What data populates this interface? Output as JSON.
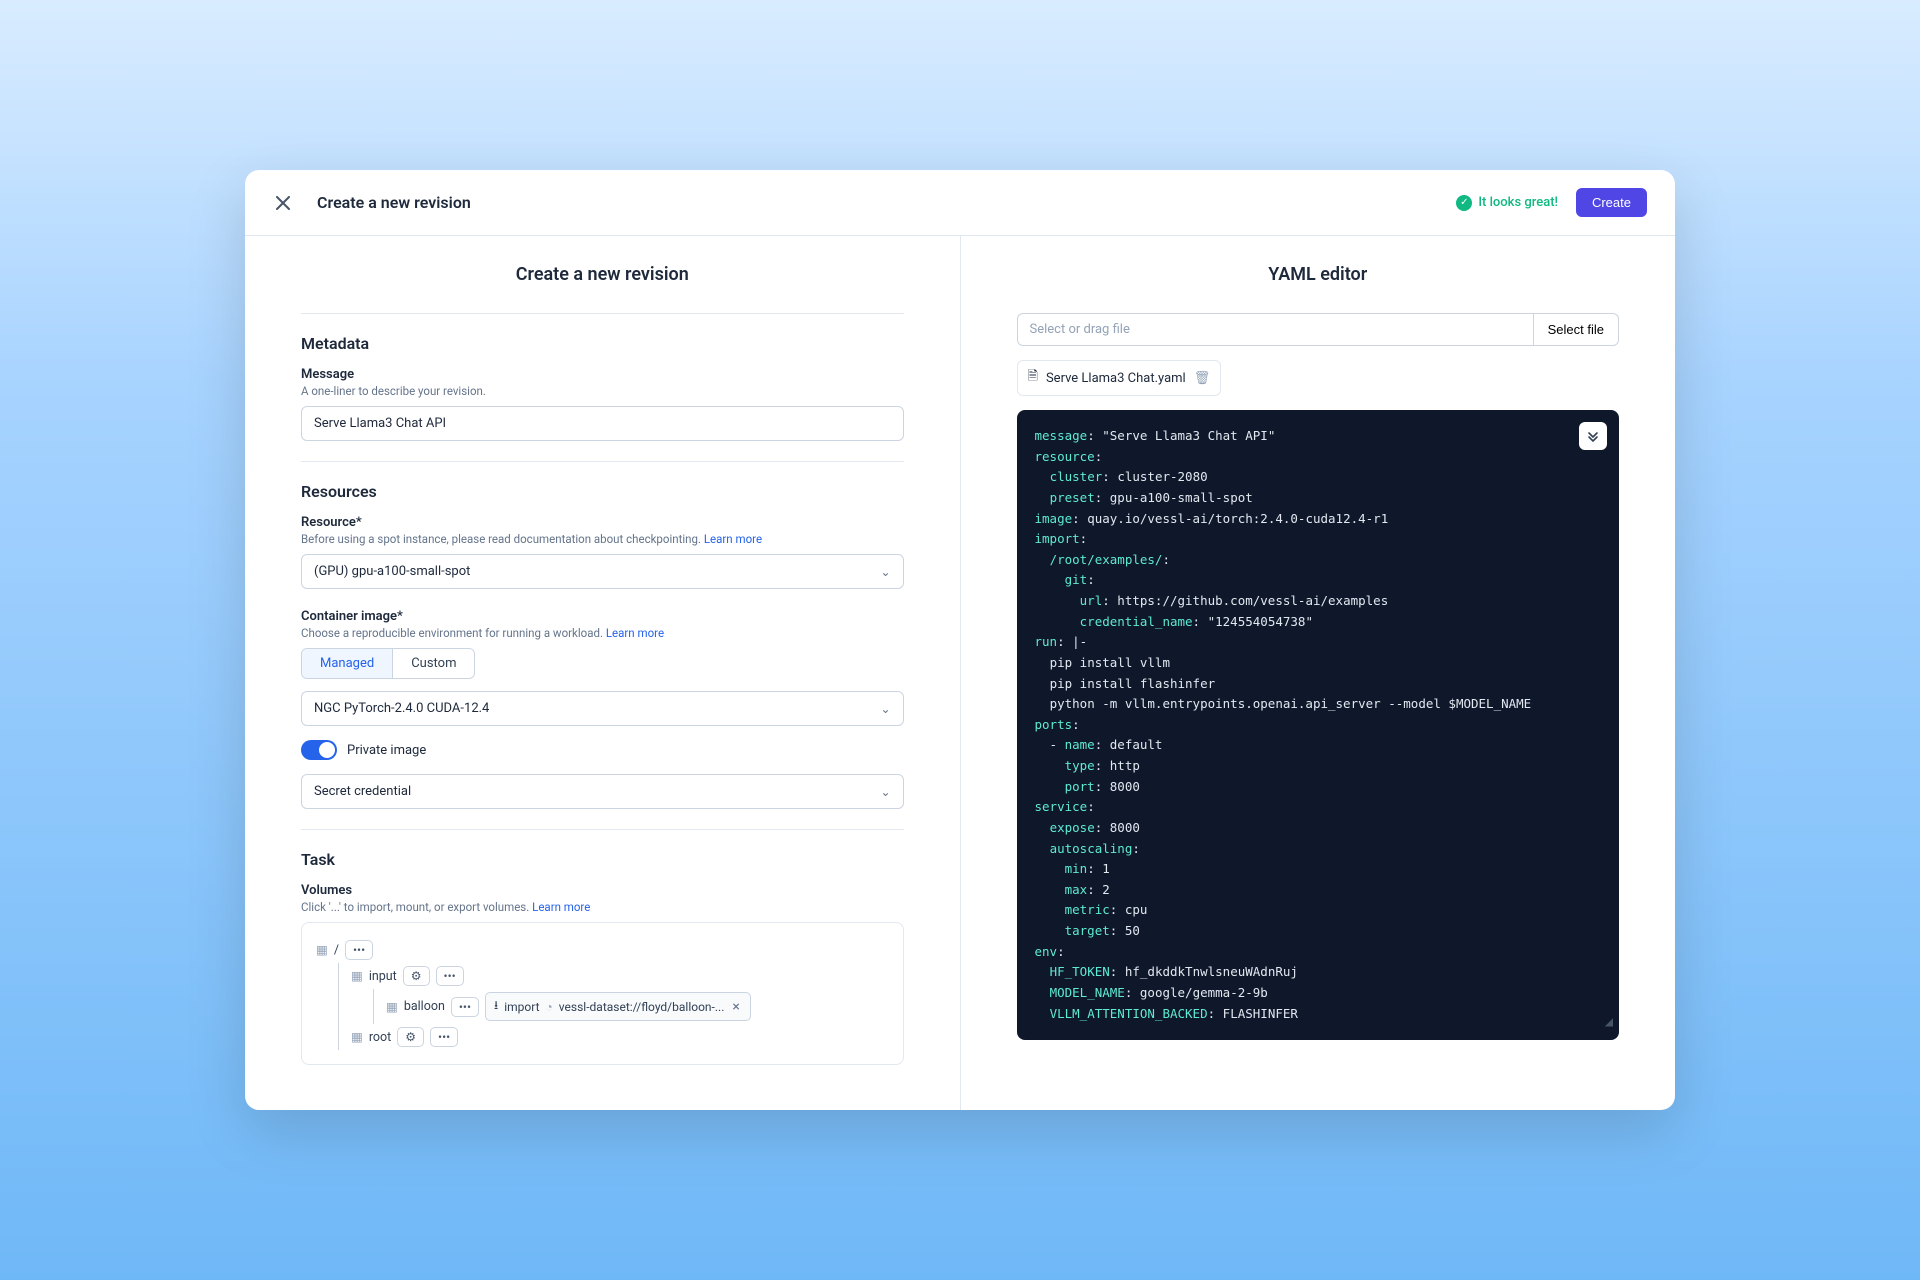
{
  "titlebar": {
    "title": "Create a new revision",
    "status_text": "It looks great!",
    "create_button": "Create"
  },
  "left_panel_title": "Create a new revision",
  "metadata": {
    "heading": "Metadata",
    "message_label": "Message",
    "message_note": "A one-liner to describe your revision.",
    "message_value": "Serve Llama3 Chat API"
  },
  "resources": {
    "heading": "Resources",
    "resource_label": "Resource*",
    "resource_note": "Before using a spot instance, please read documentation about checkpointing.",
    "resource_value": "(GPU) gpu-a100-small-spot",
    "image_label": "Container image*",
    "image_note": "Choose a reproducible environment for running a workload.",
    "tabs": {
      "managed": "Managed",
      "custom": "Custom"
    },
    "image_value": "NGC PyTorch-2.4.0 CUDA-12.4",
    "private_image_label": "Private image",
    "credential_value": "Secret credential",
    "learn_more": "Learn more"
  },
  "task": {
    "heading": "Task",
    "volumes_label": "Volumes",
    "volumes_note": "Click '...' to import, mount, or export volumes.",
    "root": "/",
    "folders": {
      "input": "input",
      "balloon": "balloon",
      "root": "root"
    },
    "import_label": "import",
    "import_path": "vessl-dataset://floyd/balloon-..."
  },
  "right_panel_title": "YAML editor",
  "file_picker": {
    "placeholder": "Select or drag file",
    "button": "Select file"
  },
  "file_pill": "Serve Llama3 Chat.yaml",
  "yaml": {
    "message": "\"Serve Llama3 Chat API\"",
    "resource": {
      "cluster": "cluster-2080",
      "preset": "gpu-a100-small-spot"
    },
    "image": "quay.io/vessl-ai/torch:2.4.0-cuda12.4-r1",
    "import_path": "/root/examples/",
    "git_url": "https://github.com/vessl-ai/examples",
    "git_credential": "\"124554054738\"",
    "run_lines": {
      "indicator": "|-",
      "l1": "pip install vllm",
      "l2": "pip install flashinfer",
      "l3": "python -m vllm.entrypoints.openai.api_server --model $MODEL_NAME"
    },
    "ports": {
      "name": "default",
      "type": "http",
      "port": "8000"
    },
    "service": {
      "expose": "8000",
      "autoscaling": {
        "min": "1",
        "max": "2",
        "metric": "cpu",
        "target": "50"
      }
    },
    "env": {
      "HF_TOKEN": "hf_dkddkTnwlsneuWAdnRuj",
      "MODEL_NAME": "google/gemma-2-9b",
      "VLLM_ATTENTION_BACKED": "FLASHINFER"
    }
  }
}
